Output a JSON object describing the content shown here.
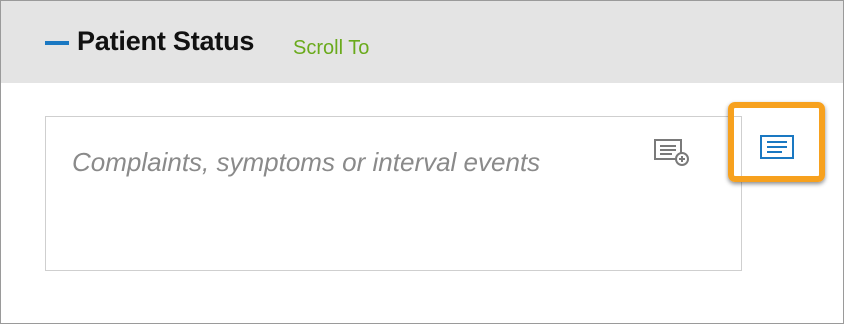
{
  "section": {
    "title": "Patient Status",
    "scroll_link": "Scroll To"
  },
  "notes": {
    "placeholder": "Complaints, symptoms or interval events"
  },
  "icons": {
    "collapse": "minus-icon",
    "add_template": "add-template-icon",
    "text_template": "text-template-icon"
  },
  "colors": {
    "accent_blue": "#1a78c2",
    "link_green": "#6aaa1c",
    "highlight_orange": "#f7a11e",
    "header_gray": "#e4e4e4"
  }
}
